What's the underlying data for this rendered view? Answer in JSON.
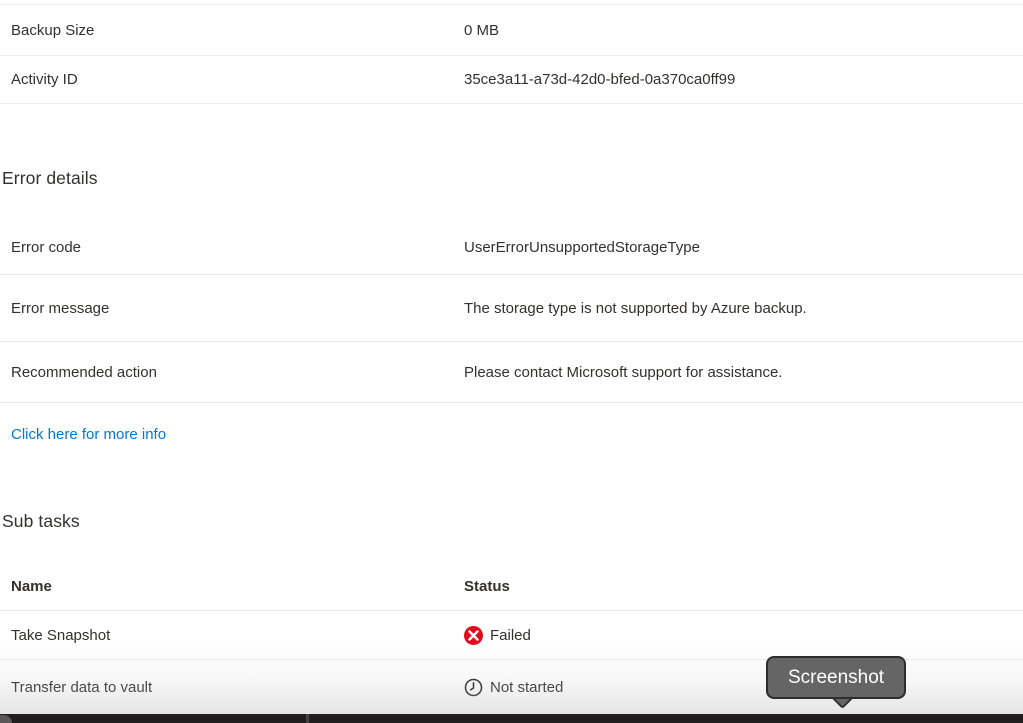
{
  "colors": {
    "text": "#323130",
    "divider": "#eaeaea",
    "link_blue": "#0078d4",
    "failed_red": "#e00b1c",
    "tooltip_gray": "#656565"
  },
  "details": {
    "rows": [
      {
        "label": "Backup Size",
        "value": "0 MB"
      },
      {
        "label": "Activity ID",
        "value": "35ce3a11-a73d-42d0-bfed-0a370ca0ff99"
      }
    ]
  },
  "error_section": {
    "heading": "Error details",
    "rows": [
      {
        "label": "Error code",
        "value": "UserErrorUnsupportedStorageType"
      },
      {
        "label": "Error message",
        "value": "The storage type is not supported by Azure backup."
      },
      {
        "label": "Recommended action",
        "value": "Please contact Microsoft support for assistance."
      }
    ],
    "more_info_link": "Click here for more info"
  },
  "subtasks": {
    "heading": "Sub tasks",
    "columns": {
      "name": "Name",
      "status": "Status"
    },
    "rows": [
      {
        "name": "Take Snapshot",
        "status": "Failed",
        "icon": "failed-icon"
      },
      {
        "name": "Transfer data to vault",
        "status": "Not started",
        "icon": "clock-icon"
      }
    ]
  },
  "overlay": {
    "tooltip_label": "Screenshot"
  }
}
